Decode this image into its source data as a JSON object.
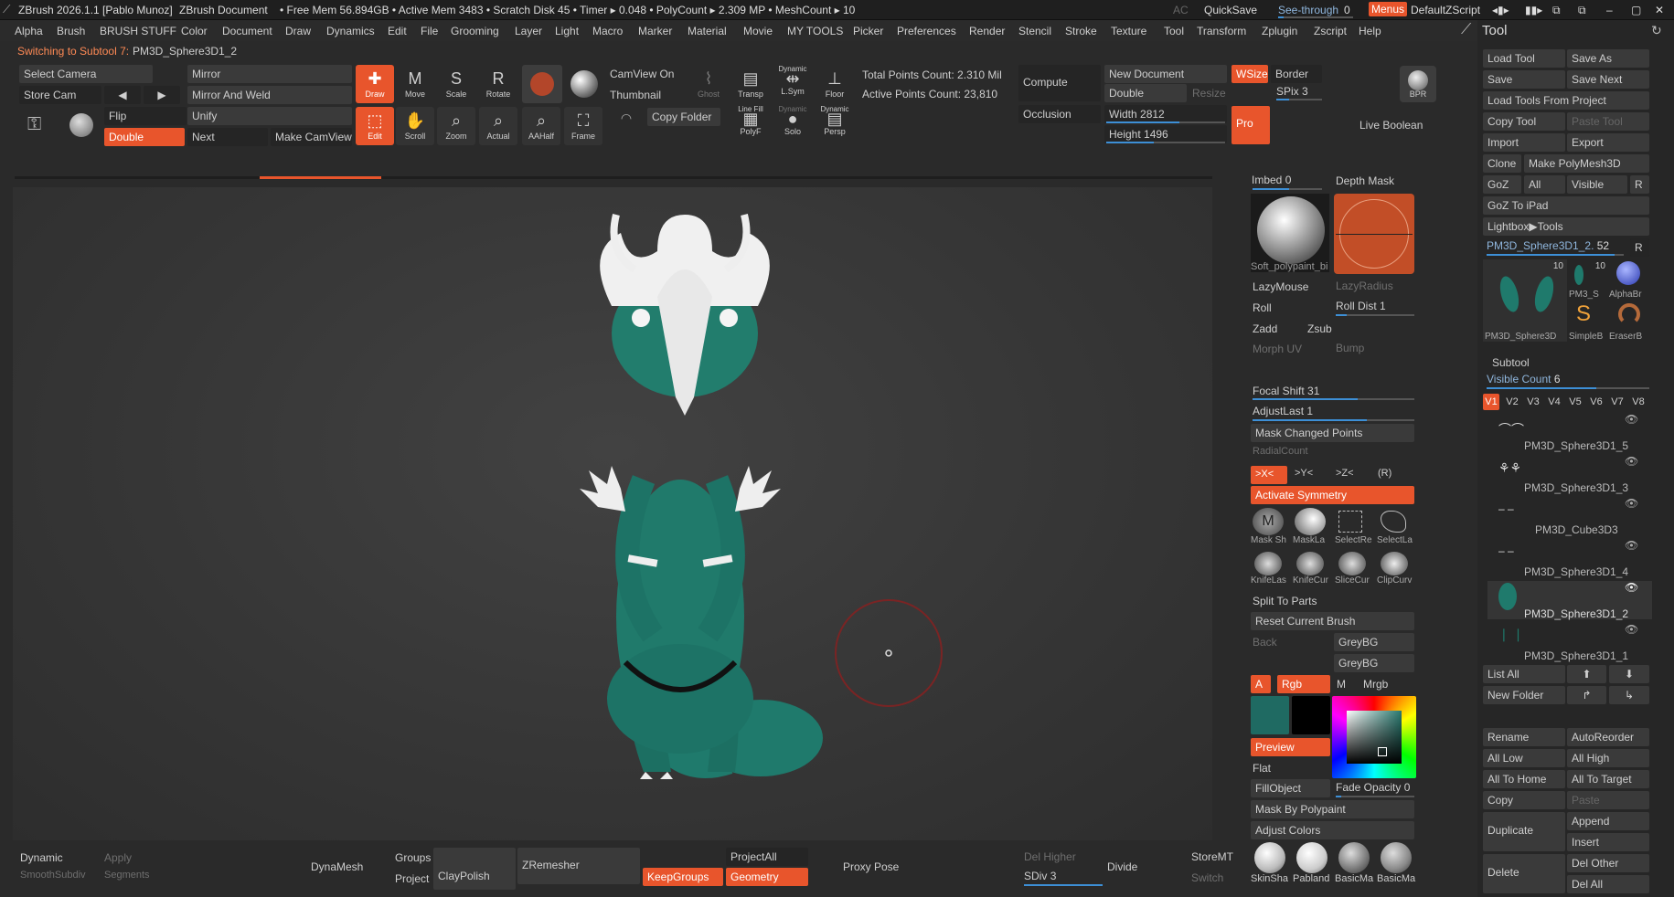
{
  "titlebar": {
    "app": "ZBrush 2026.1.1 [Pablo Munoz]",
    "document": "ZBrush Document",
    "stats": "• Free Mem 56.894GB • Active Mem 3483 • Scratch Disk 45 • Timer ▸ 0.048 • PolyCount ▸ 2.309 MP • MeshCount ▸ 10",
    "ac": "AC",
    "quicksave": "QuickSave",
    "seethrough": "See-through",
    "seethrough_value": "0",
    "menus": "Menus",
    "script": "DefaultZScript"
  },
  "menubar": [
    "Alpha",
    "Brush",
    "BRUSH STUFF",
    "Color",
    "Document",
    "Draw",
    "Dynamics",
    "Edit",
    "File",
    "Grooming",
    "Layer",
    "Light",
    "Macro",
    "Marker",
    "Material",
    "Movie",
    "MY TOOLS",
    "Picker",
    "Preferences",
    "Render",
    "Stencil",
    "Stroke",
    "Texture",
    "Tool",
    "Transform",
    "Zplugin",
    "Zscript",
    "Help"
  ],
  "status": {
    "prefix": "Switching to Subtool 7:",
    "name": "PM3D_Sphere3D1_2"
  },
  "shelf": {
    "select_camera": "Select Camera",
    "store_cam": "Store Cam",
    "mirror": "Mirror",
    "mirror_weld": "Mirror And Weld",
    "flip": "Flip",
    "unify": "Unify",
    "double": "Double",
    "next": "Next",
    "make_camview": "Make CamView",
    "draw": "Draw",
    "move": "Move",
    "scale": "Scale",
    "rotate": "Rotate",
    "edit": "Edit",
    "scroll": "Scroll",
    "zoom": "Zoom",
    "actual": "Actual",
    "aahalf": "AAHalf",
    "frame": "Frame",
    "camview_on": "CamView On",
    "thumbnail": "Thumbnail",
    "copy_folder": "Copy Folder",
    "ghost": "Ghost",
    "transp": "Transp",
    "lsym_top": "Dynamic",
    "lsym": "L.Sym",
    "floor": "Floor",
    "line_fill": "Line Fill",
    "polyf": "PolyF",
    "solo_top": "Dynamic",
    "solo": "Solo",
    "persp_top": "Dynamic",
    "persp": "Persp",
    "total_points": "Total Points Count: 2.310 Mil",
    "active_points": "Active Points Count: 23,810",
    "compute": "Compute",
    "occlusion": "Occlusion",
    "new_document": "New Document",
    "double2": "Double",
    "resize": "Resize",
    "width_label": "Width",
    "width_value": "2812",
    "height_label": "Height",
    "height_value": "1496",
    "wsize": "WSize",
    "border": "Border",
    "spix_label": "SPix",
    "spix_value": "3",
    "pro": "Pro",
    "bpr": "BPR",
    "live_boolean": "Live Boolean"
  },
  "right_panel": {
    "imbed_label": "Imbed",
    "imbed_value": "0",
    "depth_mask": "Depth Mask",
    "brush_name": "Soft_polypaint_bi",
    "lazymouse": "LazyMouse",
    "lazyradius": "LazyRadius",
    "roll": "Roll",
    "roll_dist_label": "Roll Dist",
    "roll_dist_value": "1",
    "zadd": "Zadd",
    "zsub": "Zsub",
    "morph_uv": "Morph UV",
    "bump": "Bump",
    "focal_shift_label": "Focal Shift",
    "focal_shift_value": "31",
    "adjust_last_label": "AdjustLast",
    "adjust_last_value": "1",
    "mask_changed": "Mask Changed Points",
    "radial_count": "RadialCount",
    "sym_x": ">X<",
    "sym_y": ">Y<",
    "sym_z": ">Z<",
    "sym_r": "(R)",
    "activate_symmetry": "Activate Symmetry",
    "masks": [
      "Mask Sh",
      "MaskLa",
      "SelectRe",
      "SelectLa"
    ],
    "cuts": [
      "KnifeLas",
      "KnifeCur",
      "SliceCur",
      "ClipCurv"
    ],
    "split_to_parts": "Split To Parts",
    "reset_brush": "Reset Current Brush",
    "back": "Back",
    "greybg1": "GreyBG",
    "greybg2": "GreyBG",
    "a": "A",
    "rgb": "Rgb",
    "m": "M",
    "mrgb": "Mrgb",
    "preview": "Preview",
    "flat": "Flat",
    "fillobject": "FillObject",
    "fade_opacity_label": "Fade Opacity",
    "fade_opacity_value": "0",
    "mask_polypaint": "Mask By Polypaint",
    "adjust_colors": "Adjust Colors",
    "materials": [
      "SkinSha",
      "Pabland",
      "BasicMa",
      "BasicMa"
    ],
    "primary_color": "#1f6a62",
    "secondary_color": "#000000"
  },
  "tool_panel": {
    "title": "Tool",
    "load_tool": "Load Tool",
    "save_as": "Save As",
    "save": "Save",
    "save_next": "Save Next",
    "load_from_project": "Load Tools From Project",
    "copy_tool": "Copy Tool",
    "paste_tool": "Paste Tool",
    "import": "Import",
    "export": "Export",
    "clone": "Clone",
    "make_polymesh": "Make PolyMesh3D",
    "goz": "GoZ",
    "all": "All",
    "visible": "Visible",
    "r": "R",
    "goz_ipad": "GoZ To iPad",
    "lightbox": "Lightbox▶Tools",
    "current_tool_label": "PM3D_Sphere3D1_2.",
    "current_tool_value": "52",
    "thumb_labels": [
      "PM3D_Sphere3D",
      "PM3_S",
      "AlphaBr",
      "SimpleB",
      "EraserB"
    ],
    "thumb_count1": "10",
    "thumb_count2": "10",
    "subtool_header": "Subtool",
    "visible_count_label": "Visible Count",
    "visible_count_value": "6",
    "v_tabs": [
      "V1",
      "V2",
      "V3",
      "V4",
      "V5",
      "V6",
      "V7",
      "V8"
    ],
    "subtools": [
      "PM3D_Sphere3D1_5",
      "PM3D_Sphere3D1_3",
      "PM3D_Cube3D3",
      "PM3D_Sphere3D1_4",
      "PM3D_Sphere3D1_2",
      "PM3D_Sphere3D1_1"
    ],
    "list_all": "List All",
    "new_folder": "New Folder",
    "rename": "Rename",
    "autoreorder": "AutoReorder",
    "all_low": "All Low",
    "all_high": "All High",
    "all_to_home": "All To Home",
    "all_to_target": "All To Target",
    "copy": "Copy",
    "paste": "Paste",
    "duplicate": "Duplicate",
    "append": "Append",
    "insert": "Insert",
    "delete": "Delete",
    "del_other": "Del Other",
    "del_all": "Del All"
  },
  "bottom": {
    "dynamic": "Dynamic",
    "apply": "Apply",
    "smoothsubdiv": "SmoothSubdiv",
    "segments": "Segments",
    "dynamesh": "DynaMesh",
    "groups": "Groups",
    "project": "Project",
    "claypolish": "ClayPolish",
    "zremesher": "ZRemesher",
    "keepgroups": "KeepGroups",
    "projectall": "ProjectAll",
    "geometry": "Geometry",
    "proxy_pose": "Proxy Pose",
    "del_higher": "Del Higher",
    "sdiv_label": "SDiv",
    "sdiv_value": "3",
    "divide": "Divide",
    "storemt": "StoreMT",
    "switch": "Switch"
  }
}
